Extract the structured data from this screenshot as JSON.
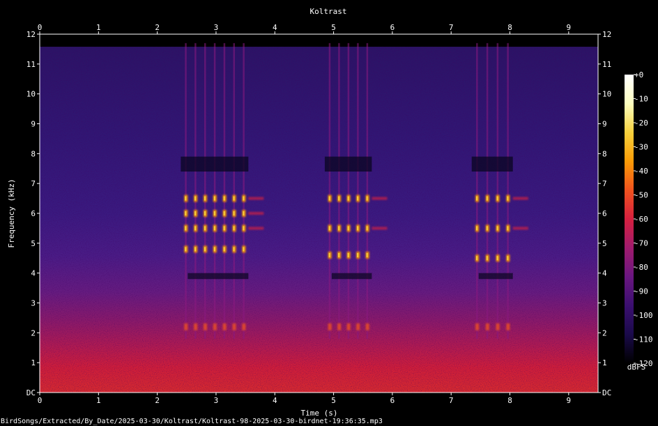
{
  "chart_data": {
    "type": "heatmap",
    "title": "Koltrast",
    "xlabel": "Time (s)",
    "ylabel": "Frequency (kHz)",
    "xlim": [
      0,
      9.5
    ],
    "ylim": [
      0,
      12
    ],
    "x_ticks": [
      "0",
      "1",
      "2",
      "3",
      "4",
      "5",
      "6",
      "7",
      "8",
      "9"
    ],
    "y_ticks": [
      "DC",
      "1",
      "2",
      "3",
      "4",
      "5",
      "6",
      "7",
      "8",
      "9",
      "10",
      "11",
      "12"
    ],
    "colorbar": {
      "label": "dBFS",
      "ticks": [
        "+0",
        "-10",
        "-20",
        "-30",
        "-40",
        "-50",
        "-60",
        "-70",
        "-80",
        "-90",
        "-100",
        "-110",
        "-120"
      ],
      "range": [
        -120,
        0
      ],
      "colors": [
        "#000000",
        "#1a0a4a",
        "#3b0f70",
        "#6a1680",
        "#a01b6d",
        "#d6203f",
        "#f0521e",
        "#fb9b06",
        "#f7d13d",
        "#fcfdbf",
        "#ffffff"
      ]
    },
    "song_bursts": [
      {
        "start": 2.4,
        "end": 3.55,
        "notes_kHz": [
          6.5,
          6.0,
          5.5,
          4.8,
          2.2
        ]
      },
      {
        "start": 4.85,
        "end": 5.65,
        "notes_kHz": [
          6.5,
          5.5,
          4.6,
          2.2
        ]
      },
      {
        "start": 7.35,
        "end": 8.05,
        "notes_kHz": [
          6.5,
          5.5,
          4.5,
          2.2
        ]
      }
    ]
  },
  "footer": {
    "file_path": "BirdSongs/Extracted/By_Date/2025-03-30/Koltrast/Koltrast-98-2025-03-30-birdnet-19:36:35.mp3"
  }
}
